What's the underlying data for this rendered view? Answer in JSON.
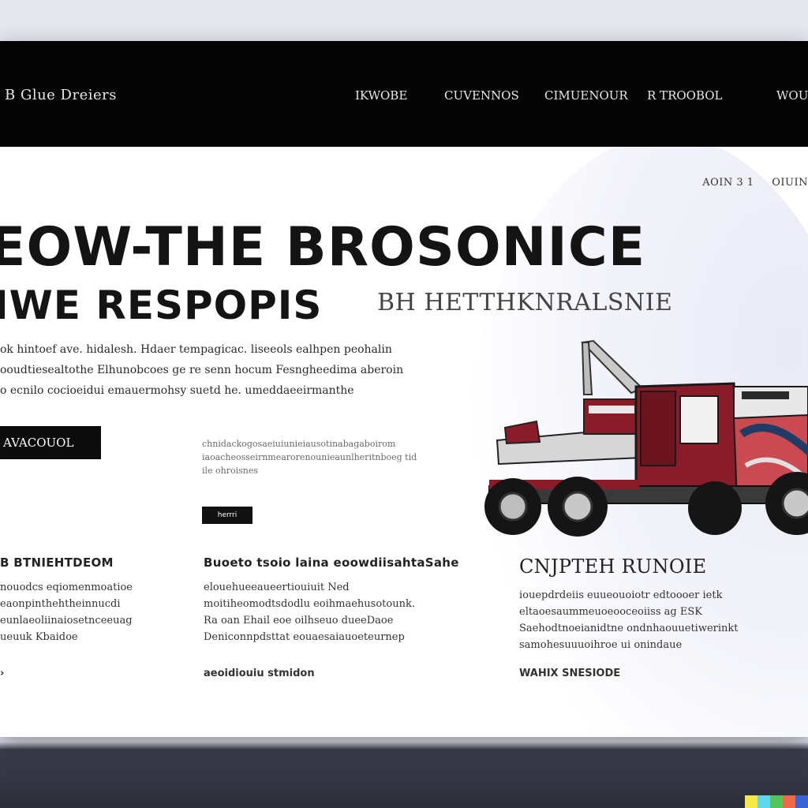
{
  "header": {
    "brand": "B Glue Dreiers",
    "nav": [
      "IKWOBE",
      "CUVENNOS",
      "CIMUENOUR",
      "R TROOBOL",
      "WOU"
    ]
  },
  "breadcrumb": [
    "AOIN 3 1",
    "OIUIN"
  ],
  "hero": {
    "title_line1": "EOW-THE BROSONICE",
    "title_line2": "IWE RESPOPIS",
    "title_line2_suffix": "BH HETTHKNRALSNIE",
    "intro_lines": [
      "ok hintoef ave. hidalesh. Hdaer tempagicac. liseeols ealhpen peohalin",
      "ooudtiesealtothe Elhunobcoes ge re senn hocum Fesngheedima aberoin",
      "o ecnilo cocioeidui emauermohsy suetd he. umeddaeeirmanthe"
    ],
    "cta_label": "AVACOUOL",
    "mid_text": [
      "chnidackogosaeiuiunieiausotinabagaboirom",
      "iaoacheosseirnmearorenounieaunlheritnboeg tid",
      "ile ohroisnes"
    ],
    "small_button_label": "herrri"
  },
  "columns": [
    {
      "title": "B BTNIEHTDEOM",
      "lines": [
        "nouodcs eqiomenmoatioe",
        "eaonpinthehtheinnucdi",
        "eunlaeoliinaiosetnceeuag",
        "ueuuk Kbaidoe"
      ],
      "more": "›"
    },
    {
      "title": "Buoeto tsoio laina eoowdiisahtaSahe",
      "lines": [
        "elouehueeaueertiouiuit Ned",
        "moitiheomodtsdodlu eoihmaehusotounk.",
        "Ra oan Ehail eoe oilhseuo dueeDaoe",
        "Deniconnpdsttat eouaesaiauoeteurnep"
      ],
      "more": "aeoidiouiu stmidon"
    },
    {
      "title": "CNJPTEH RUNOIE",
      "lines": [
        "iouepdrdeiis euueouoiotr edtoooer ietk",
        "eltaoesaummeuoeooceoiiss ag ESK",
        "Saehodtnoeianidtne ondnhaouuetiwerinkt",
        "samohesuuuoihroe ui onindaue"
      ],
      "more": "WAHIX SNESIODE"
    }
  ],
  "colors": {
    "topbar": "#050505",
    "truck_red": "#8a1c2a",
    "accent_strip": [
      "#f5e84a",
      "#62d8ef",
      "#55c45a",
      "#ee6a4b",
      "#3a63d6"
    ]
  }
}
